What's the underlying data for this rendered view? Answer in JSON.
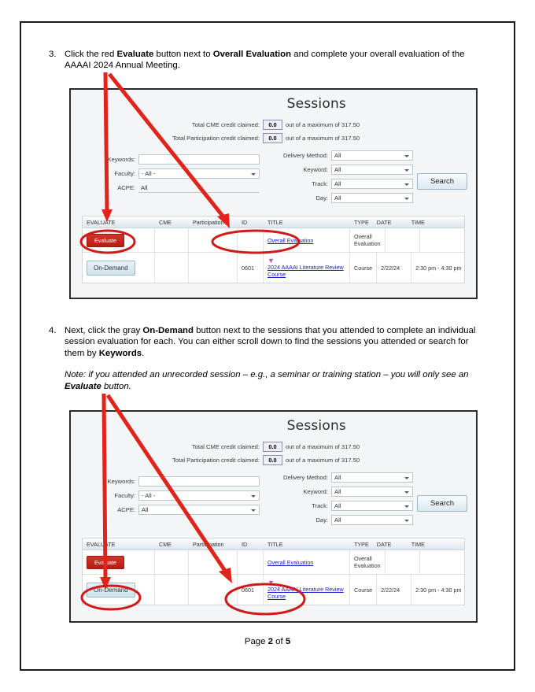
{
  "document": {
    "footer_prefix": "Page ",
    "footer_page": "2",
    "footer_mid": " of ",
    "footer_total": "5"
  },
  "steps": [
    {
      "number": "3.",
      "parts": [
        {
          "text": "Click the red ",
          "bold": false
        },
        {
          "text": "Evaluate",
          "bold": true
        },
        {
          "text": " button next to ",
          "bold": false
        },
        {
          "text": "Overall Evaluation",
          "bold": true
        },
        {
          "text": " and complete your overall evaluation of the AAAAI 2024 Annual Meeting.",
          "bold": false
        }
      ]
    },
    {
      "number": "4.",
      "parts": [
        {
          "text": "Next, click the gray ",
          "bold": false
        },
        {
          "text": "On-Demand",
          "bold": true
        },
        {
          "text": " button next to the sessions that you attended to complete an individual session evaluation for each. You can either scroll down to find the sessions you attended or search for them by ",
          "bold": false
        },
        {
          "text": "Keywords",
          "bold": true
        },
        {
          "text": ".",
          "bold": false
        }
      ],
      "note": [
        {
          "text": "Note: if you attended an unrecorded session – e.g., a seminar or training station – you will only see an ",
          "bold": false
        },
        {
          "text": "Evaluate",
          "bold": true
        },
        {
          "text": " button.",
          "bold": false
        }
      ]
    }
  ],
  "app": {
    "title": "Sessions",
    "credits": [
      {
        "label": "Total CME credit claimed:",
        "value": "0.0",
        "tail": "out of a maximum of 317.50"
      },
      {
        "label": "Total Participation credit claimed:",
        "value": "0.0",
        "tail": "out of a maximum of 317.50"
      }
    ],
    "form_left": [
      {
        "label": "Keywords:",
        "value": "",
        "type": "text"
      },
      {
        "label": "Faculty:",
        "value": "- All -",
        "type": "select"
      },
      {
        "label": "ACPE:",
        "value": "All",
        "type": "select"
      }
    ],
    "form_mid": [
      {
        "label": "Delivery Method:",
        "value": "All",
        "type": "select"
      },
      {
        "label": "Keyword:",
        "value": "All",
        "type": "select"
      },
      {
        "label": "Track:",
        "value": "All",
        "type": "select"
      },
      {
        "label": "Day:",
        "value": "All",
        "type": "select"
      }
    ],
    "search_label": "Search",
    "table": {
      "headers": [
        "EVALUATE",
        "CME",
        "Participation",
        "ID",
        "TITLE",
        "TYPE",
        "DATE",
        "TIME"
      ],
      "rows": [
        {
          "button": "Evaluate",
          "button_kind": "evaluate",
          "cme": "",
          "participation": "",
          "id": "",
          "title": "Overall Evaluation",
          "mark": "",
          "type": "Overall Evaluation",
          "date": "",
          "time": ""
        },
        {
          "button": "On-Demand",
          "button_kind": "ondemand",
          "cme": "",
          "participation": "",
          "id": "0601",
          "title": "2024 AAAAI Literature Review Course",
          "mark": "▼",
          "type": "Course",
          "date": "2/22/24",
          "time": "2:30 pm - 4:30 pm"
        }
      ]
    }
  },
  "annotations": {
    "color": "#e2231a",
    "items": [
      {
        "name": "arrow-to-evaluate-button",
        "kind": "arrow"
      },
      {
        "name": "arrow-to-overall-evaluation-link",
        "kind": "arrow"
      },
      {
        "name": "ellipse-evaluate-button",
        "kind": "ellipse"
      },
      {
        "name": "ellipse-overall-evaluation-link",
        "kind": "ellipse"
      },
      {
        "name": "arrow-to-ondemand-button",
        "kind": "arrow"
      },
      {
        "name": "arrow-to-session-title-link",
        "kind": "arrow"
      },
      {
        "name": "ellipse-ondemand-button",
        "kind": "ellipse"
      },
      {
        "name": "ellipse-session-title-link",
        "kind": "ellipse"
      }
    ]
  }
}
